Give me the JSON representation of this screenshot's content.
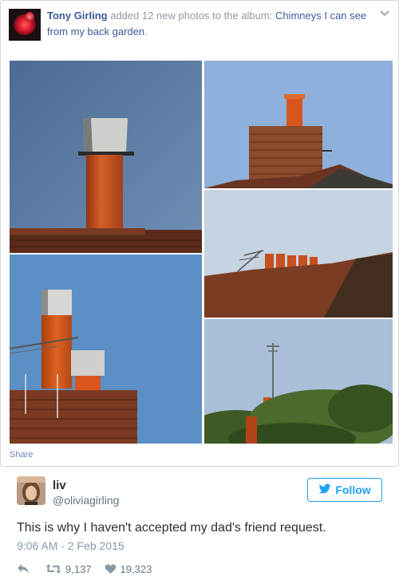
{
  "post": {
    "author": "Tony Girling",
    "action_text": "added 12 new photos to the album:",
    "album_title": "Chimneys I can see from my back garden",
    "period": ".",
    "share_label": "Share"
  },
  "photos": [
    {
      "name": "chimney-photo-1",
      "subject": "orange chimney with metal cowl"
    },
    {
      "name": "chimney-photo-2",
      "subject": "brick stack with orange pot"
    },
    {
      "name": "chimney-photo-3",
      "subject": "row of chimney pots with antenna"
    },
    {
      "name": "chimney-photo-4",
      "subject": "chimney pots with antenna"
    },
    {
      "name": "chimney-photo-5",
      "subject": "distant antenna over trees"
    }
  ],
  "tweet": {
    "name": "liv",
    "handle": "@oliviagirling",
    "follow_label": "Follow",
    "text": "This is why I haven't accepted my dad's friend request.",
    "timestamp": "9:06 AM - 2 Feb 2015",
    "retweets": "9,137",
    "likes": "19,323"
  },
  "icons": {
    "reply": "reply-icon",
    "retweet": "retweet-icon",
    "like": "heart-icon",
    "bird": "twitter-bird-icon",
    "menu": "chevron-down-icon"
  },
  "colors": {
    "fb_link": "#3b5998",
    "twitter_blue": "#1da1f2",
    "chimney_orange": "#c8521f",
    "sky_blue": "#5b88c0"
  }
}
